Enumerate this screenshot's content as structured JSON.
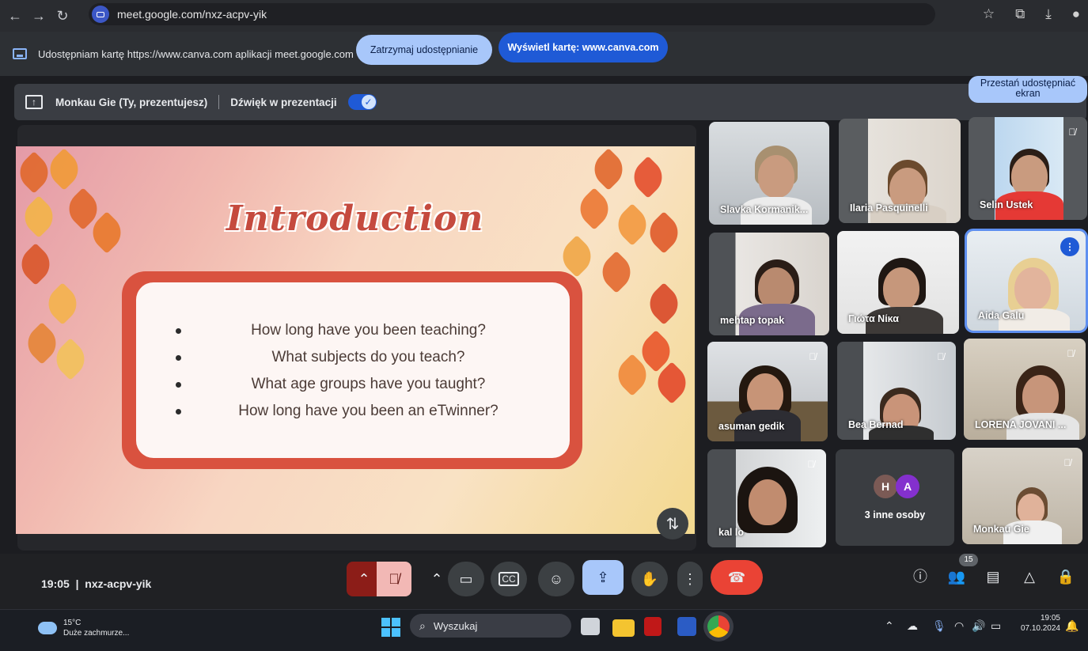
{
  "browser": {
    "url": "meet.google.com/nxz-acpv-yik"
  },
  "share_bar": {
    "message": "Udostępniam kartę https://www.canva.com aplikacji meet.google.com",
    "stop_button": "Zatrzymaj udostępnianie",
    "show_tab_button": "Wyświetl kartę: www.canva.com"
  },
  "presenting_bar": {
    "presenter": "Monkau Gie (Ty, prezentujesz)",
    "audio_label": "Dźwięk w prezentacji",
    "audio_on": true,
    "stop_screen_button": "Przestań udostępniać ekran"
  },
  "slide": {
    "title": "Introduction",
    "questions": [
      "How long have you been teaching?",
      "What subjects do you teach?",
      "What age groups have you taught?",
      "How long have you been an eTwinner?"
    ]
  },
  "participants": [
    {
      "name": "Slavka Kormanik...",
      "muted": false
    },
    {
      "name": "Ilaria Pasquinelli",
      "muted": false
    },
    {
      "name": "Selin Ustek",
      "muted": true
    },
    {
      "name": "mehtap topak",
      "muted": false
    },
    {
      "name": "Γιώτα Νίκα",
      "muted": false
    },
    {
      "name": "Aida Galu",
      "muted": false,
      "speaking": true
    },
    {
      "name": "asuman gedik",
      "muted": true
    },
    {
      "name": "Bea Bernad",
      "muted": true
    },
    {
      "name": "LORENA JOVANI ...",
      "muted": true
    },
    {
      "name": "kal lo",
      "muted": true
    },
    {
      "name": "3 inne osoby",
      "avatars": [
        "H",
        "A"
      ],
      "avatar_colors": [
        "#7b5a55",
        "#8430ce"
      ]
    },
    {
      "name": "Monkau Gie",
      "muted": true
    }
  ],
  "meet_bar": {
    "time": "19:05",
    "separator": "|",
    "meeting_code": "nxz-acpv-yik",
    "people_count": "15"
  },
  "taskbar": {
    "temperature": "15°C",
    "weather": "Duże zachmurze...",
    "search_placeholder": "Wyszukaj",
    "time": "19:05",
    "date": "07.10.2024"
  },
  "colors": {
    "accent_blue": "#a8c7fa",
    "brand_blue": "#1f5ad6",
    "end_call_red": "#ea4335",
    "slide_frame": "#d9523f"
  }
}
